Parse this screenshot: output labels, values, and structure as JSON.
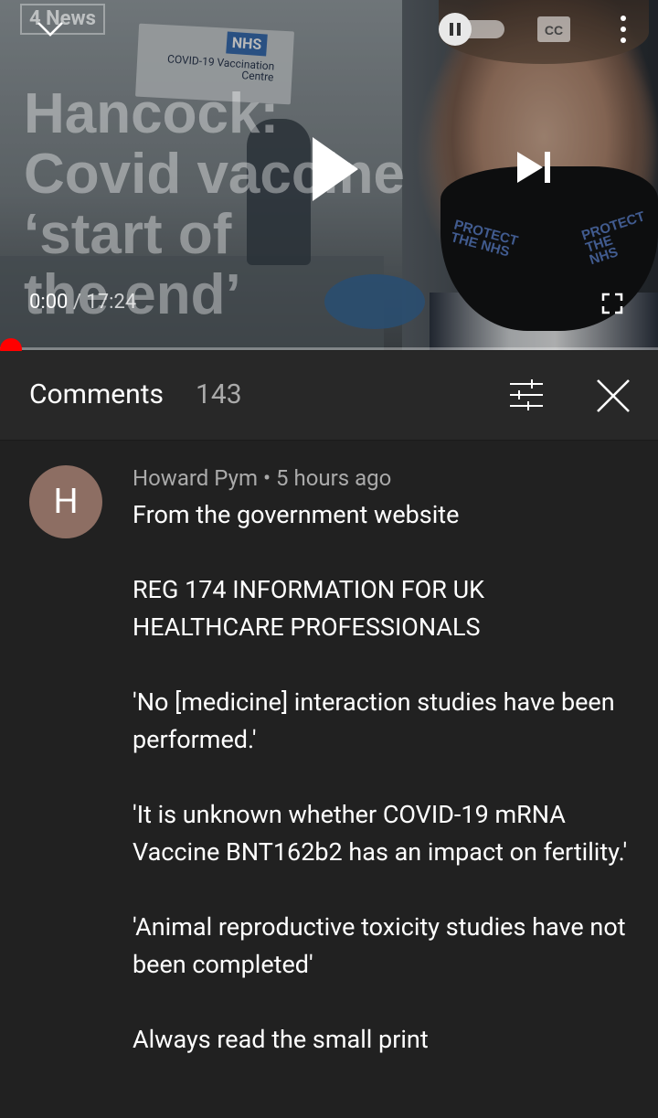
{
  "player": {
    "channel_logo": "4 News",
    "headline_lines": [
      "Hancock:",
      "Covid vaccine",
      "‘start of",
      "the end’"
    ],
    "sign_text": "COVID-19 Vaccination Centre",
    "sign_logo": "NHS",
    "mask_text_left": "PROTECT THE NHS",
    "mask_text_right": "PROTECT THE NHS",
    "current_time": "0:00",
    "separator": " / ",
    "duration": "17:24",
    "cc_label": "CC",
    "progress": 0,
    "autoplay_on": true
  },
  "comments_panel": {
    "title": "Comments",
    "count": "143"
  },
  "comment": {
    "avatar_letter": "H",
    "author": "Howard Pym",
    "time": "5 hours ago",
    "lines": [
      "From the government website",
      "",
      "REG 174 INFORMATION FOR UK HEALTHCARE PROFESSIONALS",
      "",
      "'No [medicine] interaction studies have been performed.'",
      "",
      "'It is unknown whether COVID-19 mRNA Vaccine BNT162b2 has an impact on fertility.'",
      "",
      "'Animal reproductive toxicity studies have not been completed'",
      "",
      "Always read the small print"
    ]
  },
  "colors": {
    "progress": "#ff0000",
    "background": "#212121",
    "header": "#282828",
    "avatar": "#8d6e63"
  }
}
